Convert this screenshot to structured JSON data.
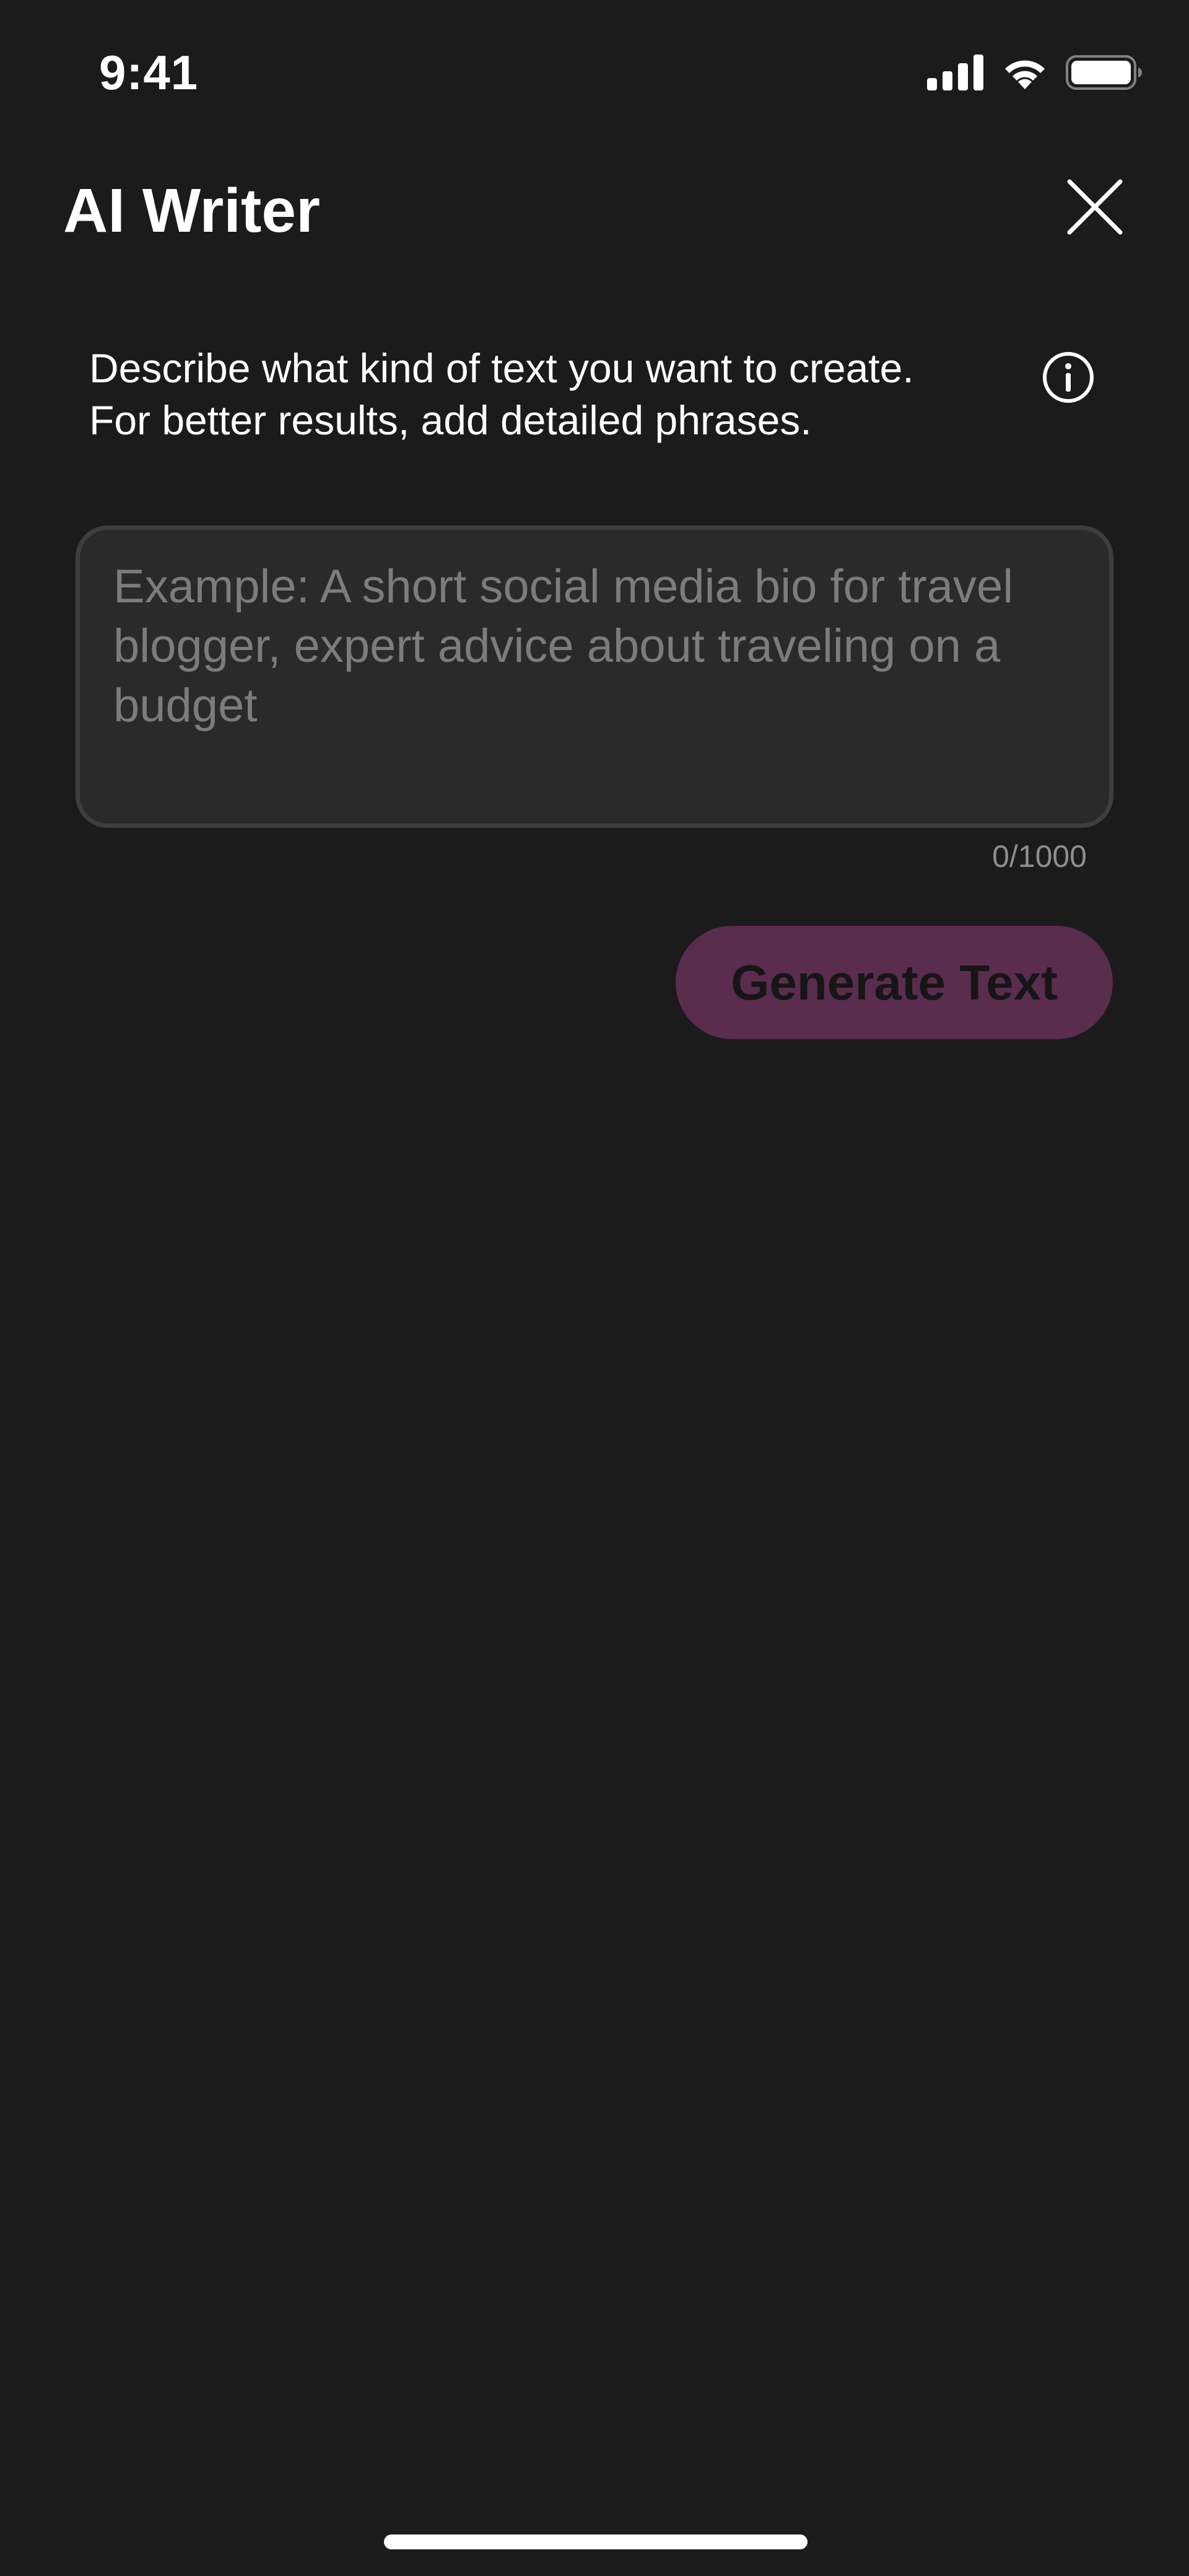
{
  "status_bar": {
    "time": "9:41",
    "icons": [
      "cellular-signal-icon",
      "wifi-icon",
      "battery-icon"
    ]
  },
  "header": {
    "title": "AI Writer",
    "close_icon": "close-icon"
  },
  "description": {
    "text": "Describe what kind of text you want to create. For better results, add detailed phrases.",
    "info_icon": "info-icon"
  },
  "prompt": {
    "value": "",
    "placeholder": "Example: A short social media bio for travel blogger, expert advice about traveling on a budget",
    "counter": "0/1000"
  },
  "actions": {
    "generate_label": "Generate Text"
  },
  "colors": {
    "background": "#1b1b1b",
    "input_background": "#2a2a2a",
    "input_border": "#3e3e3e",
    "placeholder": "#7c7c7c",
    "button_disabled": "#5a2c4e",
    "text": "#ffffff"
  }
}
